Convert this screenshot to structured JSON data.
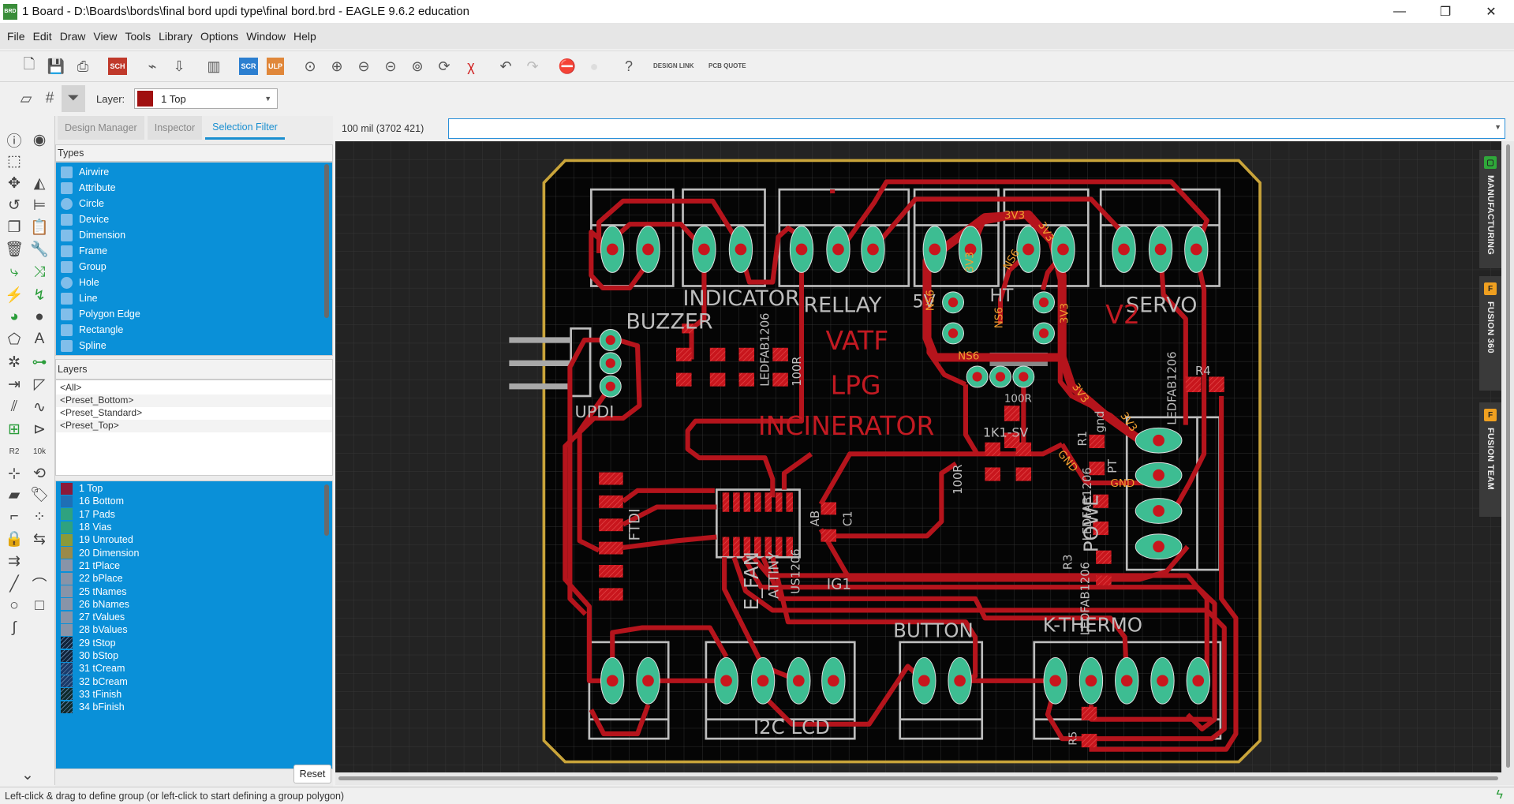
{
  "window": {
    "title": "1 Board - D:\\Boards\\bords\\final bord updi type\\final bord.brd - EAGLE 9.6.2 education",
    "app_icon": "BRD",
    "minimize": "—",
    "maximize": "❐",
    "close": "✕"
  },
  "menu": [
    "File",
    "Edit",
    "Draw",
    "View",
    "Tools",
    "Library",
    "Options",
    "Window",
    "Help"
  ],
  "toolbar": {
    "items": [
      {
        "name": "new-file-icon",
        "glyph": "🗋"
      },
      {
        "name": "save-icon",
        "glyph": "💾"
      },
      {
        "name": "print-icon",
        "glyph": "⎙"
      },
      {
        "name": "sch-brd-switch-icon",
        "glyph": "SCH",
        "color": "#c0392b",
        "sep": true
      },
      {
        "name": "cam-processor-icon",
        "glyph": "⌁",
        "sep": true
      },
      {
        "name": "manufacturing-export-icon",
        "glyph": "⇩"
      },
      {
        "name": "3d-package-icon",
        "glyph": "▥",
        "sep": true
      },
      {
        "name": "run-script-icon",
        "glyph": "SCR",
        "color": "#2c7fd0",
        "sep": true
      },
      {
        "name": "run-ulp-icon",
        "glyph": "ULP",
        "color": "#e0873a"
      },
      {
        "name": "zoom-fit-icon",
        "glyph": "⊙",
        "sep": true
      },
      {
        "name": "zoom-in-icon",
        "glyph": "⊕"
      },
      {
        "name": "zoom-out-icon",
        "glyph": "⊖"
      },
      {
        "name": "zoom-previous-icon",
        "glyph": "⊝"
      },
      {
        "name": "zoom-select-icon",
        "glyph": "⊚"
      },
      {
        "name": "redraw-icon",
        "glyph": "⟳"
      },
      {
        "name": "ratsnest-icon",
        "glyph": "χ",
        "color": "#d02020"
      },
      {
        "name": "undo-icon",
        "glyph": "↶",
        "sep": true
      },
      {
        "name": "redo-icon",
        "glyph": "↷",
        "color": "#bbb"
      },
      {
        "name": "stop-icon",
        "glyph": "⛔",
        "color": "#d02020",
        "sep": true
      },
      {
        "name": "go-icon",
        "glyph": "●",
        "color": "#ddd"
      },
      {
        "name": "help-icon",
        "glyph": "?",
        "sep": true
      }
    ],
    "design_link": "DESIGN LINK",
    "pcb_quote": "PCB QUOTE"
  },
  "layer_bar": {
    "label": "Layer:",
    "selected": "1 Top",
    "color": "#a01010"
  },
  "tools": [
    {
      "name": "info-icon",
      "glyph": "ⓘ"
    },
    {
      "name": "show-icon",
      "glyph": "◉"
    },
    {
      "name": "group-select-icon",
      "glyph": "⬚"
    },
    {
      "name": "",
      "glyph": ""
    },
    {
      "name": "move-icon",
      "glyph": "✥"
    },
    {
      "name": "mirror-icon",
      "glyph": "◭"
    },
    {
      "name": "rotate-icon",
      "glyph": "↺"
    },
    {
      "name": "align-icon",
      "glyph": "⊨"
    },
    {
      "name": "copy-icon",
      "glyph": "❐"
    },
    {
      "name": "paste-icon",
      "glyph": "📋"
    },
    {
      "name": "delete-icon",
      "glyph": "🗑"
    },
    {
      "name": "change-icon",
      "glyph": "🔧"
    },
    {
      "name": "route-icon",
      "glyph": "⤷",
      "color": "#2a9d3a"
    },
    {
      "name": "ripup-icon",
      "glyph": "⤨",
      "color": "#2a9d3a"
    },
    {
      "name": "split-icon",
      "glyph": "⚡",
      "color": "#2a9d3a"
    },
    {
      "name": "optimize-icon",
      "glyph": "↯",
      "color": "#2a9d3a"
    },
    {
      "name": "via-icon",
      "glyph": "◕",
      "color": "#2a9d3a"
    },
    {
      "name": "hole-icon",
      "glyph": "●"
    },
    {
      "name": "polygon-icon",
      "glyph": "⬠"
    },
    {
      "name": "text-icon",
      "glyph": "A"
    },
    {
      "name": "signal-icon",
      "glyph": "✲"
    },
    {
      "name": "connect-icon",
      "glyph": "⊶",
      "color": "#2a9d3a"
    },
    {
      "name": "meander-icon",
      "glyph": "⇥"
    },
    {
      "name": "miter-icon",
      "glyph": "◸"
    },
    {
      "name": "dimension-icon",
      "glyph": "⫽"
    },
    {
      "name": "spline-wave-icon",
      "glyph": "∿"
    },
    {
      "name": "add-part-icon",
      "glyph": "⊞",
      "color": "#2a9d3a"
    },
    {
      "name": "add-gate-icon",
      "glyph": "⊳"
    },
    {
      "name": "name-icon",
      "glyph": "R2"
    },
    {
      "name": "value-icon",
      "glyph": "10k"
    },
    {
      "name": "smash-icon",
      "glyph": "⊹"
    },
    {
      "name": "replace-icon",
      "glyph": "⟲"
    },
    {
      "name": "package-icon",
      "glyph": "▰"
    },
    {
      "name": "attribute-tag-icon",
      "glyph": "🏷"
    },
    {
      "name": "paint-roller-icon",
      "glyph": "⌐"
    },
    {
      "name": "pinswap-icon",
      "glyph": "⁘"
    },
    {
      "name": "lock-icon",
      "glyph": "🔒"
    },
    {
      "name": "gateswap-icon",
      "glyph": "⇆"
    },
    {
      "name": "join-icon",
      "glyph": "⇉"
    },
    {
      "name": "",
      "glyph": ""
    },
    {
      "name": "line-icon",
      "glyph": "╱"
    },
    {
      "name": "arc-icon",
      "glyph": "⌒"
    },
    {
      "name": "circle-icon",
      "glyph": "○"
    },
    {
      "name": "rectangle-icon",
      "glyph": "□"
    },
    {
      "name": "spline-icon",
      "glyph": "∫"
    },
    {
      "name": "",
      "glyph": ""
    }
  ],
  "palette_more": "⌄",
  "panel": {
    "tabs": [
      "Design Manager",
      "Inspector",
      "Selection Filter"
    ],
    "active_tab": 2,
    "types_label": "Types",
    "types": [
      {
        "label": "Airwire",
        "icon": "airwire-icon"
      },
      {
        "label": "Attribute",
        "icon": "attribute-icon"
      },
      {
        "label": "Circle",
        "icon": "circle-icon"
      },
      {
        "label": "Device",
        "icon": "device-icon"
      },
      {
        "label": "Dimension",
        "icon": "dimension-icon"
      },
      {
        "label": "Frame",
        "icon": "frame-icon"
      },
      {
        "label": "Group",
        "icon": "group-icon"
      },
      {
        "label": "Hole",
        "icon": "hole-icon"
      },
      {
        "label": "Line",
        "icon": "line-icon"
      },
      {
        "label": "Polygon Edge",
        "icon": "polygon-edge-icon"
      },
      {
        "label": "Rectangle",
        "icon": "rectangle-icon"
      },
      {
        "label": "Spline",
        "icon": "spline-icon"
      }
    ],
    "layers_label": "Layers",
    "presets": [
      "<All>",
      "<Preset_Bottom>",
      "<Preset_Standard>",
      "<Preset_Top>"
    ],
    "layers": [
      {
        "label": "1 Top",
        "color": "#8b1a3a"
      },
      {
        "label": "16 Bottom",
        "color": "#1f6fb5"
      },
      {
        "label": "17 Pads",
        "color": "#2fa27f"
      },
      {
        "label": "18 Vias",
        "color": "#2fa27f"
      },
      {
        "label": "19 Unrouted",
        "color": "#8a9a3a"
      },
      {
        "label": "20 Dimension",
        "color": "#9a8a4a"
      },
      {
        "label": "21 tPlace",
        "color": "#8894a8"
      },
      {
        "label": "22 bPlace",
        "color": "#8894a8"
      },
      {
        "label": "25 tNames",
        "color": "#8894a8"
      },
      {
        "label": "26 bNames",
        "color": "#8894a8"
      },
      {
        "label": "27 tValues",
        "color": "#8894a8"
      },
      {
        "label": "28 bValues",
        "color": "#8894a8"
      },
      {
        "label": "29 tStop",
        "color": "#10233a",
        "hatch": true
      },
      {
        "label": "30 bStop",
        "color": "#10233a",
        "hatch": true
      },
      {
        "label": "31 tCream",
        "color": "#1a3a6a",
        "hatch": true
      },
      {
        "label": "32 bCream",
        "color": "#1a3a6a",
        "hatch": true
      },
      {
        "label": "33 tFinish",
        "color": "#0e2a2a",
        "hatch": true
      },
      {
        "label": "34 bFinish",
        "color": "#0e2a2a",
        "hatch": true
      }
    ],
    "reset": "Reset"
  },
  "coord": {
    "readout": "100 mil (3702 421)",
    "command": ""
  },
  "side_tabs": [
    {
      "label": "MANUFACTURING",
      "badge": "▢",
      "badge_color": "#2fa83a"
    },
    {
      "label": "FUSION 360",
      "badge": "F",
      "badge_color": "#f0a020"
    },
    {
      "label": "FUSION TEAM",
      "badge": "F",
      "badge_color": "#f0a020"
    }
  ],
  "board": {
    "colors": {
      "outline": "#c9a43a",
      "trace": "#b5141c",
      "pad": "#3dbd92",
      "silk": "#bdbdbd",
      "net_label": "#f0a030"
    },
    "labels": {
      "indicator": "INDICATOR",
      "rellay": "RELLAY",
      "servo": "SERVO",
      "buzzer": "BUZZER",
      "updi": "UPDI",
      "vatf": "VATF",
      "lpg": "LPG",
      "incinerator": "INCINERATOR",
      "v2": "V2",
      "button": "BUTTON",
      "kthermo": "K-THERMO",
      "i2c_lcd": "I2C  LCD",
      "ig1": "IG1",
      "efan": "E_FAN",
      "ftdi": "FTDI",
      "attiny": "ATTINY",
      "ledfab1": "LEDFAB1206",
      "ledfab2": "LEDFAB1206",
      "ledfab3": "LEDFAB1206",
      "ledfab4": "LEDFAB1206",
      "r100a": "100R",
      "r100b": "100R",
      "r100c": "100R",
      "r4": "R4",
      "r1": "R1",
      "r3": "R3",
      "r5": "R5",
      "k1sv": "1K1-SV",
      "ht": "HT",
      "fivev": "5V",
      "pt": "PT",
      "gnd_txt": "gnd",
      "power": "POWE",
      "us1206": "US1206",
      "ab": "AB",
      "c1": "C1"
    },
    "nets": {
      "v3a": "3V3",
      "v3b": "3V3",
      "v3c": "3V3",
      "v3d": "3V3",
      "v3e": "3V3",
      "v3f": "3V3",
      "gnd1": "GND",
      "gnd2": "GND",
      "ns1": "NS6",
      "ns2": "NS6",
      "ns3": "NS6",
      "ns4": "NS6"
    }
  },
  "status": "Left-click & drag to define group (or left-click to start defining a group polygon)",
  "status_icon": "ϟ"
}
